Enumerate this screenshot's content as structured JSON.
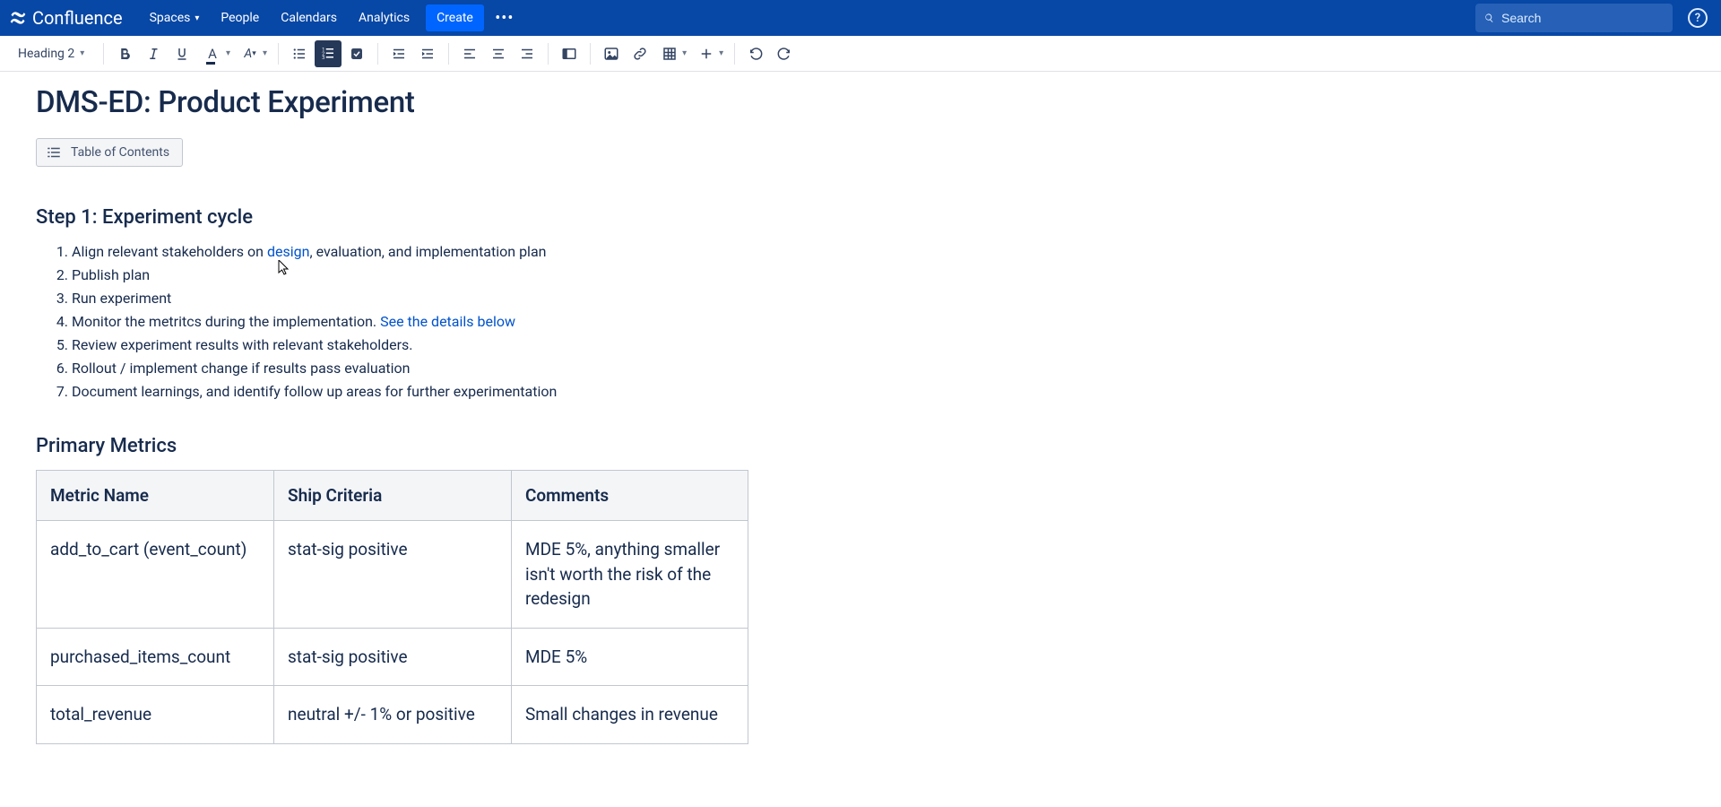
{
  "brand": "Confluence",
  "nav": {
    "spaces": "Spaces",
    "people": "People",
    "calendars": "Calendars",
    "analytics": "Analytics",
    "create": "Create"
  },
  "search": {
    "placeholder": "Search"
  },
  "toolbar": {
    "text_style": "Heading 2"
  },
  "page": {
    "title": "DMS-ED: Product Experiment",
    "toc_label": "Table of Contents",
    "section1_heading": "Step 1: Experiment cycle",
    "steps": [
      {
        "prefix": "Align relevant stakeholders on ",
        "link": "design",
        "suffix": ", evaluation, and implementation plan"
      },
      {
        "prefix": "Publish plan",
        "link": "",
        "suffix": ""
      },
      {
        "prefix": "Run experiment",
        "link": "",
        "suffix": ""
      },
      {
        "prefix": "Monitor the metritcs during the implementation. ",
        "link": "See the details below",
        "suffix": ""
      },
      {
        "prefix": "Review experiment results with relevant stakeholders.",
        "link": "",
        "suffix": ""
      },
      {
        "prefix": "Rollout / implement change if results pass evaluation",
        "link": "",
        "suffix": ""
      },
      {
        "prefix": "Document learnings, and identify follow up areas for further experimentation",
        "link": "",
        "suffix": ""
      }
    ],
    "section2_heading": "Primary Metrics",
    "table": {
      "headers": [
        "Metric Name",
        "Ship Criteria",
        "Comments"
      ],
      "rows": [
        [
          "add_to_cart (event_count)",
          "stat-sig positive",
          "MDE 5%, anything smaller isn't worth the risk of the redesign"
        ],
        [
          "purchased_items_count",
          "stat-sig positive",
          "MDE 5%"
        ],
        [
          "total_revenue",
          "neutral +/- 1% or positive",
          "Small changes in revenue"
        ]
      ]
    }
  }
}
